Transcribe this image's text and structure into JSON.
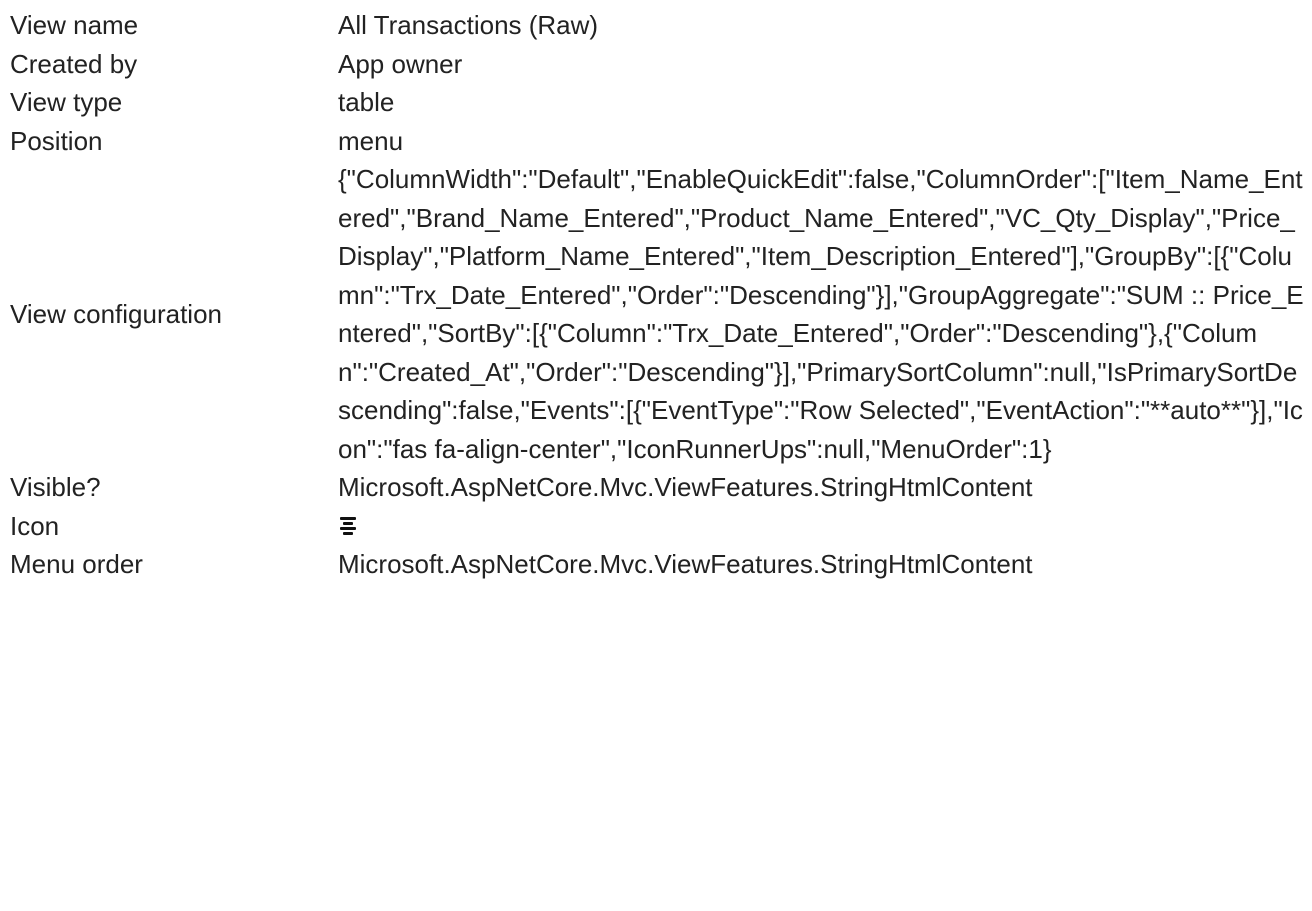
{
  "properties": {
    "view_name": {
      "label": "View name",
      "value": "All Transactions (Raw)"
    },
    "created_by": {
      "label": "Created by",
      "value": "App owner"
    },
    "view_type": {
      "label": "View type",
      "value": "table"
    },
    "position": {
      "label": "Position",
      "value": "menu"
    },
    "view_configuration": {
      "label": "View configuration",
      "value": "{\"ColumnWidth\":\"Default\",\"EnableQuickEdit\":false,\"ColumnOrder\":[\"Item_Name_Entered\",\"Brand_Name_Entered\",\"Product_Name_Entered\",\"VC_Qty_Display\",\"Price_Display\",\"Platform_Name_Entered\",\"Item_Description_Entered\"],\"GroupBy\":[{\"Column\":\"Trx_Date_Entered\",\"Order\":\"Descending\"}],\"GroupAggregate\":\"SUM :: Price_Entered\",\"SortBy\":[{\"Column\":\"Trx_Date_Entered\",\"Order\":\"Descending\"},{\"Column\":\"Created_At\",\"Order\":\"Descending\"}],\"PrimarySortColumn\":null,\"IsPrimarySortDescending\":false,\"Events\":[{\"EventType\":\"Row Selected\",\"EventAction\":\"**auto**\"}],\"Icon\":\"fas fa-align-center\",\"IconRunnerUps\":null,\"MenuOrder\":1}"
    },
    "visible": {
      "label": "Visible?",
      "value": "Microsoft.AspNetCore.Mvc.ViewFeatures.StringHtmlContent"
    },
    "icon": {
      "label": "Icon",
      "icon_name": "align-center-icon"
    },
    "menu_order": {
      "label": "Menu order",
      "value": "Microsoft.AspNetCore.Mvc.ViewFeatures.StringHtmlContent"
    }
  }
}
